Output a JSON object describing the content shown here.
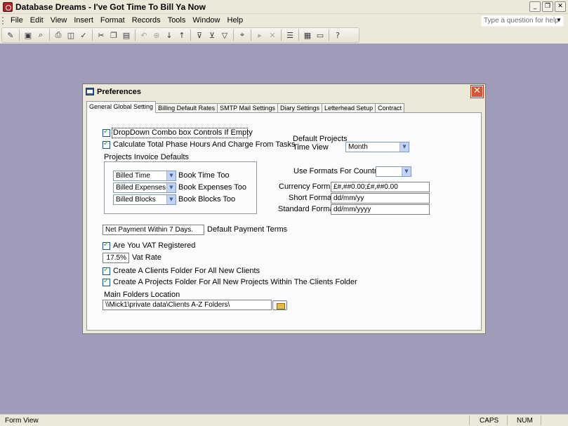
{
  "app": {
    "title": "Database Dreams - I've Got Time To Bill Ya Now"
  },
  "window_buttons": {
    "minimize": "_",
    "restore": "❐",
    "close": "✕"
  },
  "menu": {
    "items": [
      "File",
      "Edit",
      "View",
      "Insert",
      "Format",
      "Records",
      "Tools",
      "Window",
      "Help"
    ]
  },
  "help_search": {
    "placeholder": "Type a question for help"
  },
  "toolbar": {
    "icons": [
      "design-view-icon",
      "save-icon",
      "file-search-icon",
      "print-icon",
      "print-preview-icon",
      "spelling-icon",
      "cut-icon",
      "copy-icon",
      "paste-icon",
      "undo-icon",
      "insert-hyperlink-icon",
      "sort-ascending-icon",
      "sort-descending-icon",
      "filter-by-selection-icon",
      "filter-by-form-icon",
      "apply-filter-icon",
      "find-icon",
      "new-record-icon",
      "delete-record-icon",
      "properties-icon",
      "database-window-icon",
      "new-object-icon",
      "help-icon"
    ]
  },
  "dialog": {
    "title": "Preferences",
    "close": "✕",
    "tabs": [
      "General Global Setting",
      "Billing Default Rates",
      "SMTP Mail Settings",
      "Diary Settings",
      "Letterhead Setup",
      "Contract"
    ],
    "options": {
      "dropdown_combo": "DropDown Combo box Controls If Empty",
      "calc_phase_hours": "Calculate Total Phase Hours And Charge From Tasks"
    },
    "invoice_defaults": {
      "title": "Projects Invoice Defaults",
      "rows": [
        {
          "combo": "Billed Time",
          "label": "Book Time Too"
        },
        {
          "combo": "Billed Expenses",
          "label": "Book Expenses Too"
        },
        {
          "combo": "Billed Blocks",
          "label": "Book Blocks Too"
        }
      ]
    },
    "time_view": {
      "label_line1": "Default Projects",
      "label_line2": "Time View",
      "value": "Month"
    },
    "formats": {
      "use_label": "Use  Formats For Country",
      "country_value": "",
      "currency_label": "Currency Format",
      "currency_value": "£#,##0.00;£#,##0.00",
      "short_label": "Short Format",
      "short_value": "dd/mm/yy",
      "standard_label": "Standard Format",
      "standard_value": "dd/mm/yyyy"
    },
    "payment": {
      "value": "Net Payment Within 7 Days.",
      "label": "Default Payment Terms"
    },
    "vat": {
      "registered_label": "Are You VAT Registered",
      "rate_value": "17.5%",
      "rate_label": "Vat Rate"
    },
    "folders": {
      "clients_folder": "Create A Clients Folder For All New Clients",
      "projects_folder": "Create A Projects Folder For All New Projects Within The Clients Folder",
      "location_label": "Main Folders Location",
      "location_value": "\\\\Mick1\\private data\\Clients A-Z Folders\\"
    }
  },
  "status": {
    "left": "Form View",
    "caps": "CAPS",
    "num": "NUM"
  }
}
